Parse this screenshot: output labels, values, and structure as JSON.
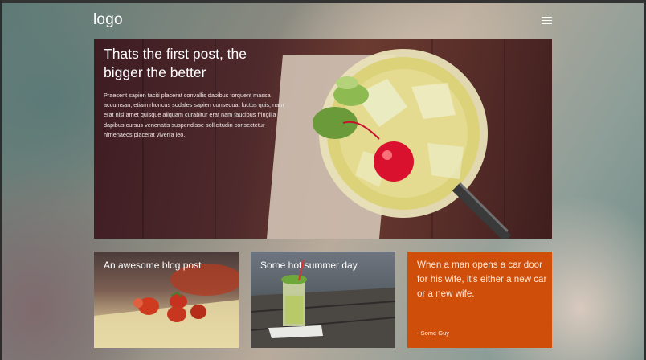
{
  "header": {
    "logo": "logo",
    "menu_icon": "hamburger-menu-icon"
  },
  "hero": {
    "title": "Thats the first post, the bigger the better",
    "body": "Praesent sapien taciti placerat convallis dapibus torquent massa accumsan, etiam rhoncus sodales sapien consequat luctus quis, nam erat nisl amet quisque aliquam curabitur erat nam faucibus fringilla dapibus cursus venenatis suspendisse sollicitudin consectetur himenaeos placerat viverra leo."
  },
  "cards": [
    {
      "title": "An awesome blog post"
    },
    {
      "title": "Some hot summer day"
    }
  ],
  "quote": {
    "text": "When a man opens a car door for his wife, it's either a new car or a new wife.",
    "author": "- Some Guy"
  },
  "colors": {
    "quote_card": "#cf4e0a",
    "text": "#ffffff"
  }
}
